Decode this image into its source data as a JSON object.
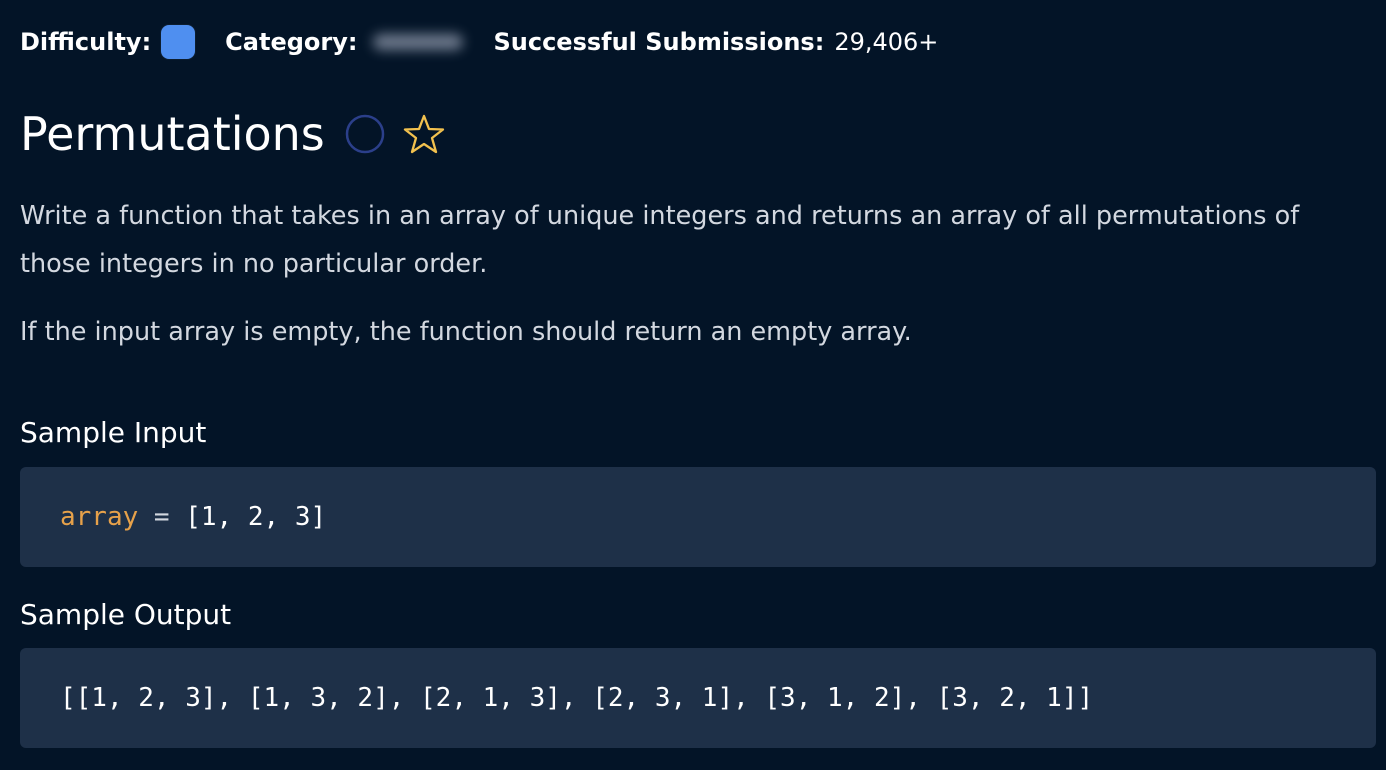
{
  "meta": {
    "difficulty_label": "Difficulty:",
    "difficulty_color": "#4f8ff0",
    "category_label": "Category:",
    "submissions_label": "Successful Submissions:",
    "submissions_value": "29,406+"
  },
  "problem": {
    "title": "Permutations",
    "completion_icon": "circle-outline-icon",
    "favorite_icon": "star-outline-icon",
    "description_1": "Write a function that takes in an array of unique integers and returns an array of all permutations of those integers in no particular order.",
    "description_2": "If the input array is empty, the function should return an empty array."
  },
  "sample_input": {
    "heading": "Sample Input",
    "variable": "array",
    "operator": " = ",
    "value": "[1, 2, 3]"
  },
  "sample_output": {
    "heading": "Sample Output",
    "value": "[[1, 2, 3], [1, 3, 2], [2, 1, 3], [2, 3, 1], [3, 1, 2], [3, 2, 1]]"
  },
  "colors": {
    "background": "#031427",
    "code_background": "#1e3048",
    "code_variable": "#e6a14a",
    "star": "#f2c14e",
    "circle": "#2b3f8a"
  }
}
